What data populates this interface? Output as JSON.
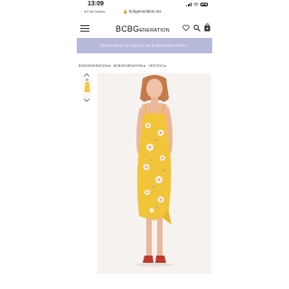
{
  "status_bar": {
    "time": "13:09",
    "carrier_back": "◂",
    "carrier": "Foto kiakas"
  },
  "browser": {
    "address": "bcbgeneration.mx"
  },
  "header": {
    "logo_main": "BCBG",
    "logo_small": "ENERATION"
  },
  "banner": {
    "text": "DESCUBRE LO NUEVO DE BCBGENERATION >"
  },
  "breadcrumb": [
    "BCBGENERATION ▸",
    "BCBGENERATION ▸",
    "VESTIDO ▸"
  ],
  "colors": {
    "banner_bg": "#b6b9d8",
    "dress_yellow": "#f2c43a",
    "photo_bg": "#f5f2ef"
  }
}
